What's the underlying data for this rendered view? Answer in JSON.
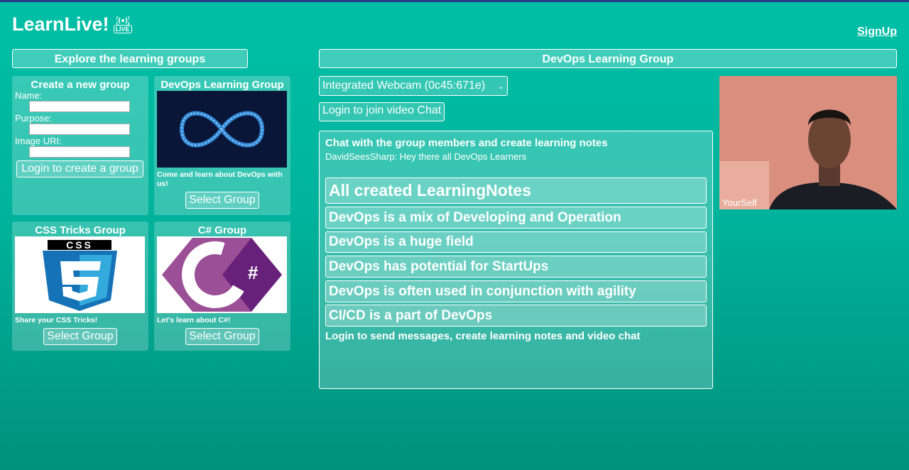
{
  "header": {
    "app_title": "LearnLive!",
    "live_badge": "LIVE",
    "signup_link": "SignUp"
  },
  "left": {
    "explore_title": "Explore the learning groups",
    "create_card": {
      "title": "Create a new group",
      "name_label": "Name:",
      "purpose_label": "Purpose:",
      "image_label": "Image URI:",
      "login_button": "Login to create a group"
    },
    "groups": [
      {
        "title": "DevOps Learning Group",
        "description": "Come and learn about DevOps with us!",
        "button": "Select Group"
      },
      {
        "title": "CSS Tricks Group",
        "description": "Share your CSS Tricks!",
        "button": "Select Group",
        "logo_text": "CSS"
      },
      {
        "title": "C# Group",
        "description": "Let's learn about C#!",
        "button": "Select Group",
        "logo_text": "#"
      }
    ]
  },
  "right": {
    "group_title": "DevOps Learning Group",
    "webcam_select": "Integrated Webcam (0c45:671e)",
    "video_login_button": "Login to join video Chat",
    "chat": {
      "heading": "Chat with the group members and create learning notes",
      "messages": [
        "DavidSeesSharp: Hey there all DevOps Learners"
      ],
      "notes_title": "All created LearningNotes",
      "notes": [
        "DevOps is a mix of Developing and Operation",
        "DevOps is a huge field",
        "DevOps has potential for StartUps",
        "DevOps is often used in conjunction with agility",
        "CI/CD is a part of DevOps"
      ],
      "login_hint": "Login to send messages, create learning notes and video chat"
    },
    "video": {
      "label": "YourSelf"
    }
  },
  "colors": {
    "accent": "#00bfa6",
    "dark_accent": "#00917c"
  }
}
